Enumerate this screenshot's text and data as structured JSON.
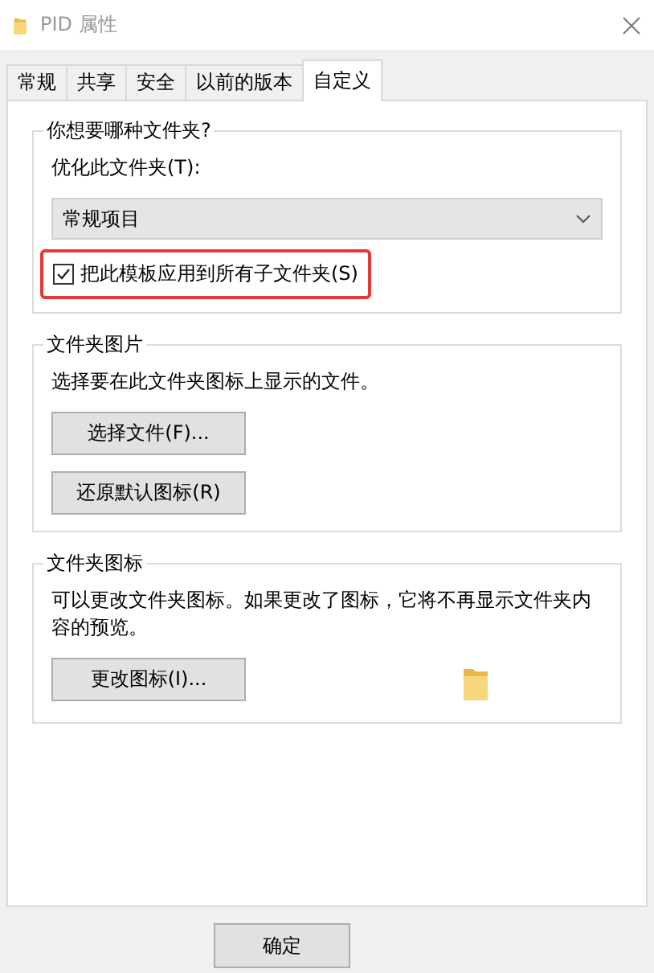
{
  "window": {
    "title": "PID 属性"
  },
  "tabs": [
    {
      "label": "常规",
      "selected": false
    },
    {
      "label": "共享",
      "selected": false
    },
    {
      "label": "安全",
      "selected": false
    },
    {
      "label": "以前的版本",
      "selected": false
    },
    {
      "label": "自定义",
      "selected": true
    }
  ],
  "folder_type": {
    "title": "你想要哪种文件夹?",
    "label": "优化此文件夹(T):",
    "dropdown": {
      "value": "常规项目"
    },
    "checkbox": {
      "label": "把此模板应用到所有子文件夹(S)",
      "checked": true,
      "highlighted": true
    }
  },
  "folder_pictures": {
    "title": "文件夹图片",
    "text": "选择要在此文件夹图标上显示的文件。",
    "buttons": [
      "选择文件(F)...",
      "还原默认图标(R)"
    ]
  },
  "folder_icons": {
    "title": "文件夹图标",
    "text": "可以更改文件夹图标。如果更改了图标，它将不再显示文件夹内容的预览。",
    "buttons": [
      "更改图标(I)..."
    ]
  },
  "dialog_buttons": [
    "确定"
  ]
}
